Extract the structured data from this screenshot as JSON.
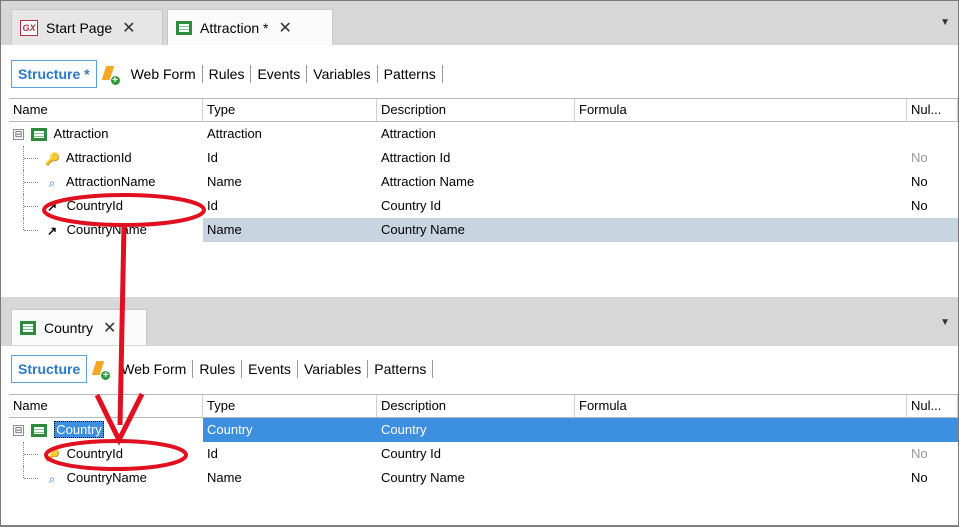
{
  "top_editor": {
    "tabs": [
      {
        "label": "Start Page",
        "icon": "gx-icon",
        "close": "✕"
      },
      {
        "label": "Attraction *",
        "icon": "transaction-icon",
        "close": "✕"
      }
    ],
    "subtabs": [
      "Structure *",
      "Web Form",
      "Rules",
      "Events",
      "Variables",
      "Patterns"
    ],
    "columns": [
      "Name",
      "Type",
      "Description",
      "Formula",
      "Nul..."
    ],
    "rows": [
      {
        "name": "Attraction",
        "type": "Attraction",
        "description": "Attraction",
        "formula": "",
        "nullable": ""
      },
      {
        "name": "AttractionId",
        "type": "Id",
        "description": "Attraction Id",
        "formula": "",
        "nullable": "No"
      },
      {
        "name": "AttractionName",
        "type": "Name",
        "description": "Attraction Name",
        "formula": "",
        "nullable": "No"
      },
      {
        "name": "CountryId",
        "type": "Id",
        "description": "Country Id",
        "formula": "",
        "nullable": "No"
      },
      {
        "name": "CountryName",
        "type": "Name",
        "description": "Country Name",
        "formula": "",
        "nullable": ""
      }
    ]
  },
  "bottom_editor": {
    "tabs": [
      {
        "label": "Country",
        "icon": "transaction-icon",
        "close": "✕"
      }
    ],
    "subtabs": [
      "Structure",
      "Web Form",
      "Rules",
      "Events",
      "Variables",
      "Patterns"
    ],
    "columns": [
      "Name",
      "Type",
      "Description",
      "Formula",
      "Nul..."
    ],
    "rows": [
      {
        "name": "Country",
        "type": "Country",
        "description": "Country",
        "formula": "",
        "nullable": ""
      },
      {
        "name": "CountryId",
        "type": "Id",
        "description": "Country Id",
        "formula": "",
        "nullable": "No"
      },
      {
        "name": "CountryName",
        "type": "Name",
        "description": "Country Name",
        "formula": "",
        "nullable": "No"
      }
    ]
  },
  "icons": {
    "gx": "GX",
    "expander": "⊟",
    "key": "🔑",
    "search": "⌕",
    "fk": "↗",
    "dropdown": "▼"
  },
  "colors": {
    "accent": "#2a78c8",
    "selection_blue": "#3d8fe0",
    "annotation_red": "#e01020",
    "transaction_green": "#2e8b3d"
  }
}
